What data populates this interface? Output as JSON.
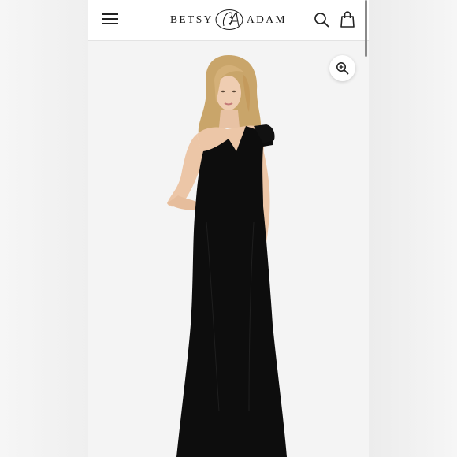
{
  "brand": {
    "name_left": "BETSY",
    "name_right": "ADAM",
    "monogram": "BA"
  },
  "header": {
    "menu_icon": "hamburger-menu-icon",
    "search_icon": "search-icon",
    "bag_icon": "shopping-bag-icon"
  },
  "product_image": {
    "zoom_icon": "zoom-in-icon",
    "dress_color": "#0d0d0d"
  },
  "colors": {
    "header_bg": "#ffffff",
    "page_bg": "#f4f4f4",
    "icon_color": "#222222"
  }
}
